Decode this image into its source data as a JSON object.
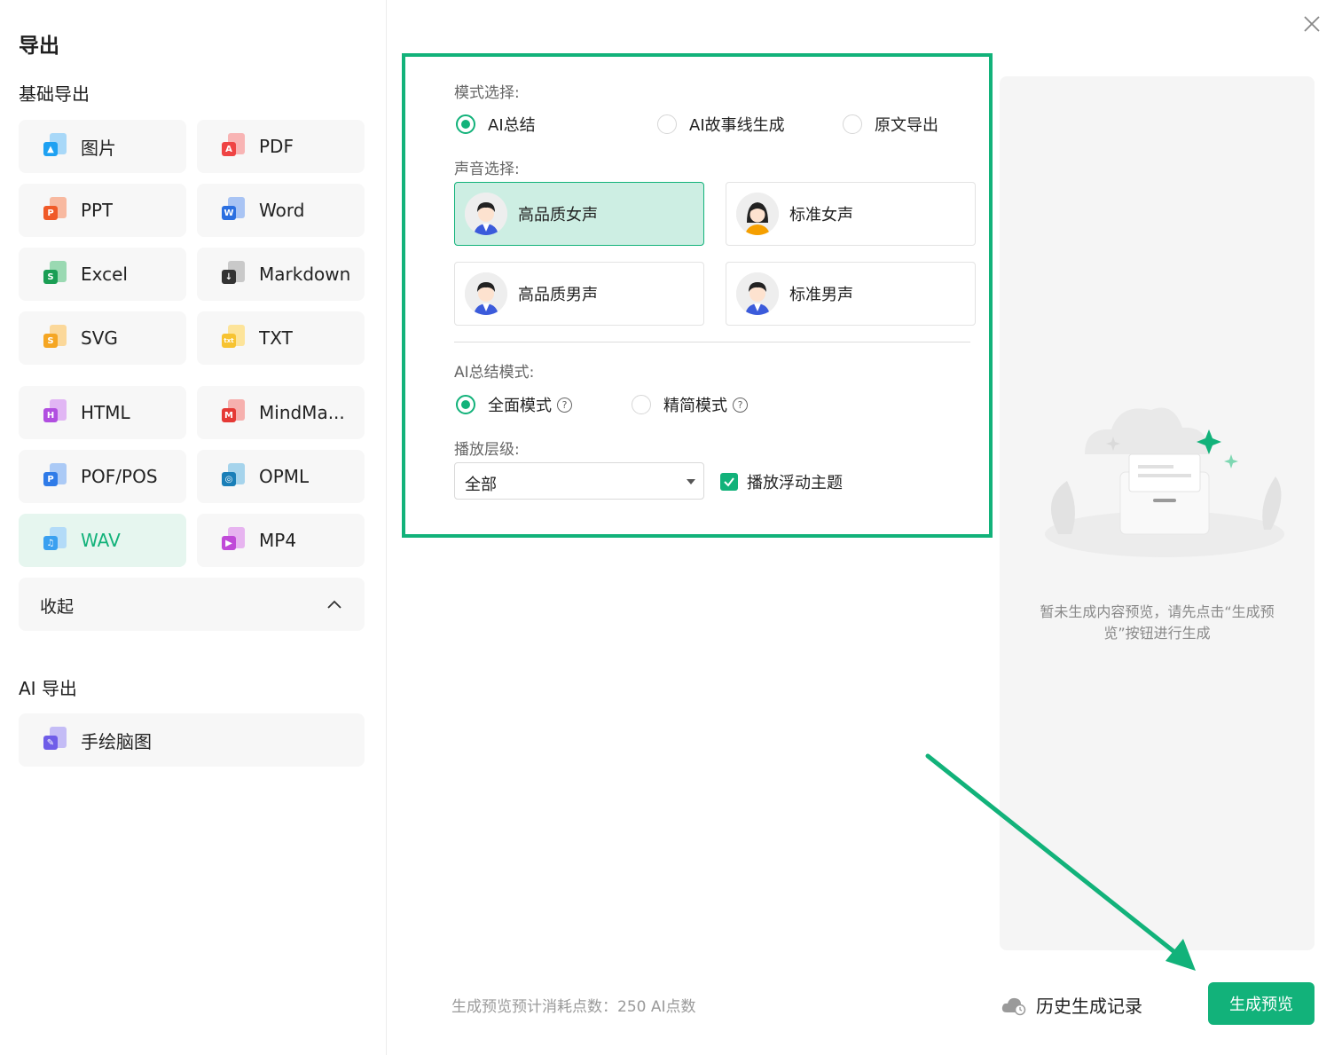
{
  "left": {
    "title": "导出",
    "basic_section": "基础导出",
    "formats": [
      {
        "label": "图片",
        "icon": "image-file-icon",
        "color": "#1ea1f2",
        "glyph": ""
      },
      {
        "label": "PDF",
        "icon": "pdf-file-icon",
        "color": "#ef4444",
        "glyph": "A"
      },
      {
        "label": "PPT",
        "icon": "ppt-file-icon",
        "color": "#f05a28",
        "glyph": "P"
      },
      {
        "label": "Word",
        "icon": "word-file-icon",
        "color": "#2b6fe0",
        "glyph": "W"
      },
      {
        "label": "Excel",
        "icon": "excel-file-icon",
        "color": "#1a9e54",
        "glyph": "S"
      },
      {
        "label": "Markdown",
        "icon": "markdown-file-icon",
        "color": "#333333",
        "glyph": "↓"
      },
      {
        "label": "SVG",
        "icon": "svg-file-icon",
        "color": "#f5a623",
        "glyph": "S"
      },
      {
        "label": "TXT",
        "icon": "txt-file-icon",
        "color": "#f7c331",
        "glyph": "txt"
      },
      {
        "label": "HTML",
        "icon": "html-file-icon",
        "color": "#b14fe0",
        "glyph": "H"
      },
      {
        "label": "MindMa...",
        "icon": "mindmanager-file-icon",
        "color": "#e53935",
        "glyph": "M"
      },
      {
        "label": "POF/POS",
        "icon": "pof-file-icon",
        "color": "#2f7be8",
        "glyph": "P"
      },
      {
        "label": "OPML",
        "icon": "opml-file-icon",
        "color": "#1a7fb8",
        "glyph": "◎"
      },
      {
        "label": "WAV",
        "icon": "wav-file-icon",
        "color": "#3aa0f0",
        "glyph": "♫"
      },
      {
        "label": "MP4",
        "icon": "mp4-file-icon",
        "color": "#c04ad8",
        "glyph": "▶"
      }
    ],
    "collapse_label": "收起",
    "ai_section": "AI 导出",
    "ai_items": [
      {
        "label": "手绘脑图",
        "icon": "hand-drawn-mindmap-icon",
        "color": "#6f5de8",
        "glyph": "✎"
      }
    ]
  },
  "settings": {
    "mode_label": "模式选择:",
    "modes": [
      "AI总结",
      "AI故事线生成",
      "原文导出"
    ],
    "voice_label": "声音选择:",
    "voices": [
      "高品质女声",
      "标准女声",
      "高品质男声",
      "标准男声"
    ],
    "summary_mode_label": "AI总结模式:",
    "summary_modes": [
      "全面模式",
      "精简模式"
    ],
    "help_glyph": "?",
    "level_label": "播放层级:",
    "level_value": "全部",
    "float_topic_label": "播放浮动主题"
  },
  "preview": {
    "empty_text": "暂未生成内容预览，请先点击“生成预览”按钮进行生成"
  },
  "footer": {
    "cost_text": "生成预览预计消耗点数：250 AI点数",
    "history_label": "历史生成记录",
    "generate_label": "生成预览"
  },
  "colors": {
    "accent": "#12b27a"
  }
}
